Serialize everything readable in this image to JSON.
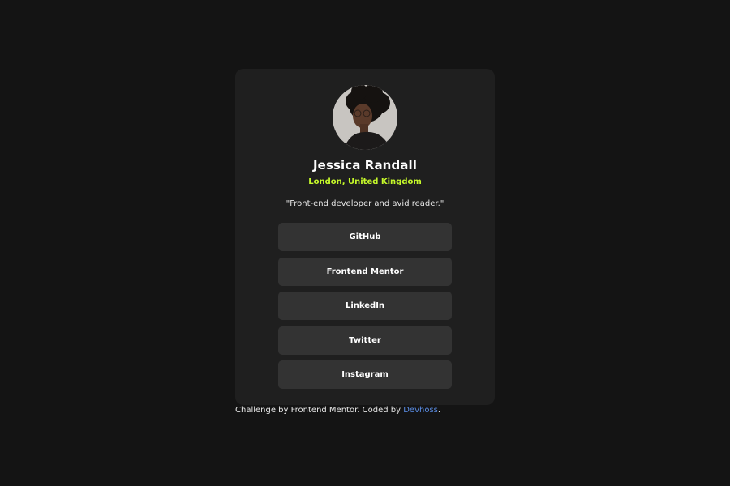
{
  "profile": {
    "avatar_alt": "Jessica Randall",
    "name": "Jessica Randall",
    "location": "London, United Kingdom",
    "bio": "\"Front-end developer and avid reader.\""
  },
  "links": [
    {
      "label": "GitHub"
    },
    {
      "label": "Frontend Mentor"
    },
    {
      "label": "LinkedIn"
    },
    {
      "label": "Twitter"
    },
    {
      "label": "Instagram"
    }
  ],
  "footer": {
    "prefix": "Challenge by Frontend Mentor. Coded by ",
    "author": "Devhoss",
    "suffix": "."
  },
  "colors": {
    "background": "#141414",
    "card": "#1f1f1f",
    "button": "#333333",
    "accent_green": "#c5f82a",
    "link_blue": "#5b8ee6"
  }
}
